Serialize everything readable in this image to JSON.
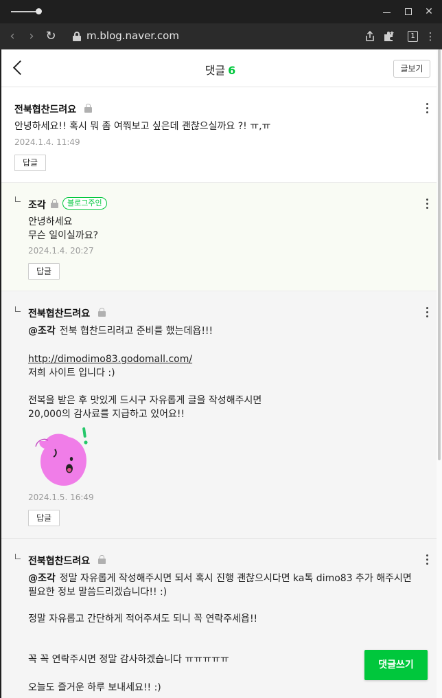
{
  "browser": {
    "url": "m.blog.naver.com",
    "tab_count": "1"
  },
  "header": {
    "title": "댓글",
    "count": "6",
    "view_post_label": "글보기"
  },
  "comments": [
    {
      "author": "전북협찬드려요",
      "lines": [
        "안녕하세요!! 혹시 뭐 좀 여쭤보고 싶은데 괜찮으실까요 ?! ㅠ,ㅠ"
      ],
      "date": "2024.1.4. 11:49",
      "reply_label": "답글"
    },
    {
      "author": "조각",
      "badge": "블로그주인",
      "lines": [
        "안녕하세요",
        "무슨 일이실까요?"
      ],
      "date": "2024.1.4. 20:27",
      "reply_label": "답글"
    },
    {
      "author": "전북협찬드려요",
      "mention": "@조각",
      "first_line": "전북 협찬드리려고 준비를 했는데욥!!!",
      "link": "http://dimodimo83.godomall.com/",
      "lines": [
        "저희 사이트 입니다 :)",
        "전복을 받은 후 맛있게 드시구 자유롭게 글을 작성해주시면",
        "20,000의 감사료를 지급하고 있어요!!"
      ],
      "date": "2024.1.5. 16:49",
      "reply_label": "답글"
    },
    {
      "author": "전북협찬드려요",
      "mention": "@조각",
      "first_line": "정말 자유롭게 작성해주시면 되서 혹시 진행 괜찮으시다면 ka톡 dimo83 추가 해주시면",
      "lines": [
        "필요한 정보 말씀드리겠습니다!! :)",
        "정말 자유롭고 간단하게 적어주셔도 되니 꼭 연락주세욥!!",
        "꼭 꼭 연락주시면 정말 감사하겠습니다 ㅠㅠㅠㅠㅠ",
        "오늘도 즐거운 하루 보내세요!! :)"
      ]
    }
  ],
  "write_comment_label": "댓글쓰기",
  "colors": {
    "accent": "#00c73c",
    "sticker": "#f07de8"
  }
}
